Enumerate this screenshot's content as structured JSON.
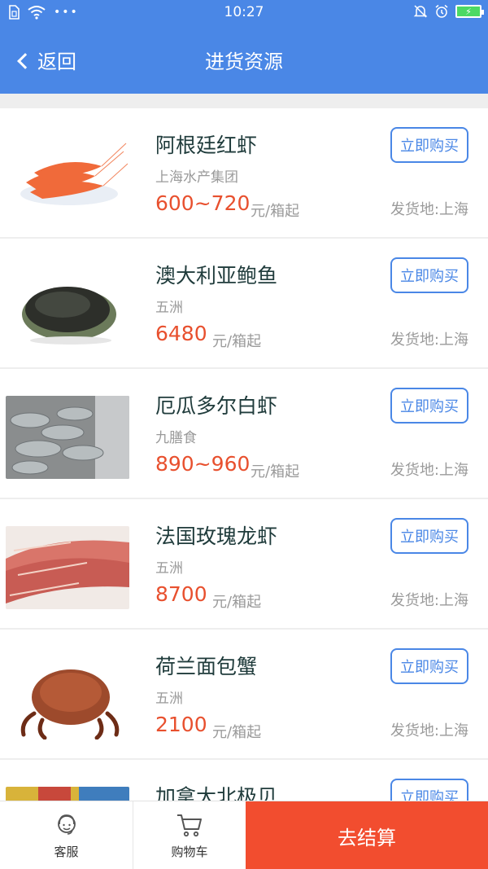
{
  "status_bar": {
    "time": "10:27",
    "battery_color": "#4cd964"
  },
  "header": {
    "back_label": "返回",
    "title": "进货资源",
    "color": "#4a87e6"
  },
  "items": [
    {
      "name": "阿根廷红虾",
      "seller": "上海水产集团",
      "price": "600~720",
      "unit": "元/箱起",
      "origin": "发货地:上海",
      "buy_label": "立即购买",
      "thumb": "shrimp-red"
    },
    {
      "name": "澳大利亚鲍鱼",
      "seller": "五洲",
      "price": "6480",
      "unit": "元/箱起",
      "origin": "发货地:上海",
      "buy_label": "立即购买",
      "thumb": "abalone"
    },
    {
      "name": "厄瓜多尔白虾",
      "seller": "九膳食",
      "price": "890~960",
      "unit": "元/箱起",
      "origin": "发货地:上海",
      "buy_label": "立即购买",
      "thumb": "shrimp-white"
    },
    {
      "name": "法国玫瑰龙虾",
      "seller": "五洲",
      "price": "8700",
      "unit": "元/箱起",
      "origin": "发货地:上海",
      "buy_label": "立即购买",
      "thumb": "lobster"
    },
    {
      "name": "荷兰面包蟹",
      "seller": "五洲",
      "price": "2100",
      "unit": "元/箱起",
      "origin": "发货地:上海",
      "buy_label": "立即购买",
      "thumb": "crab"
    },
    {
      "name": "加拿大北极贝",
      "seller": "",
      "price": "",
      "unit": "",
      "origin": "",
      "buy_label": "立即购买",
      "thumb": "clam"
    }
  ],
  "bottom_bar": {
    "service_label": "客服",
    "cart_label": "购物车",
    "checkout_label": "去结算",
    "checkout_color": "#f24d2f"
  }
}
